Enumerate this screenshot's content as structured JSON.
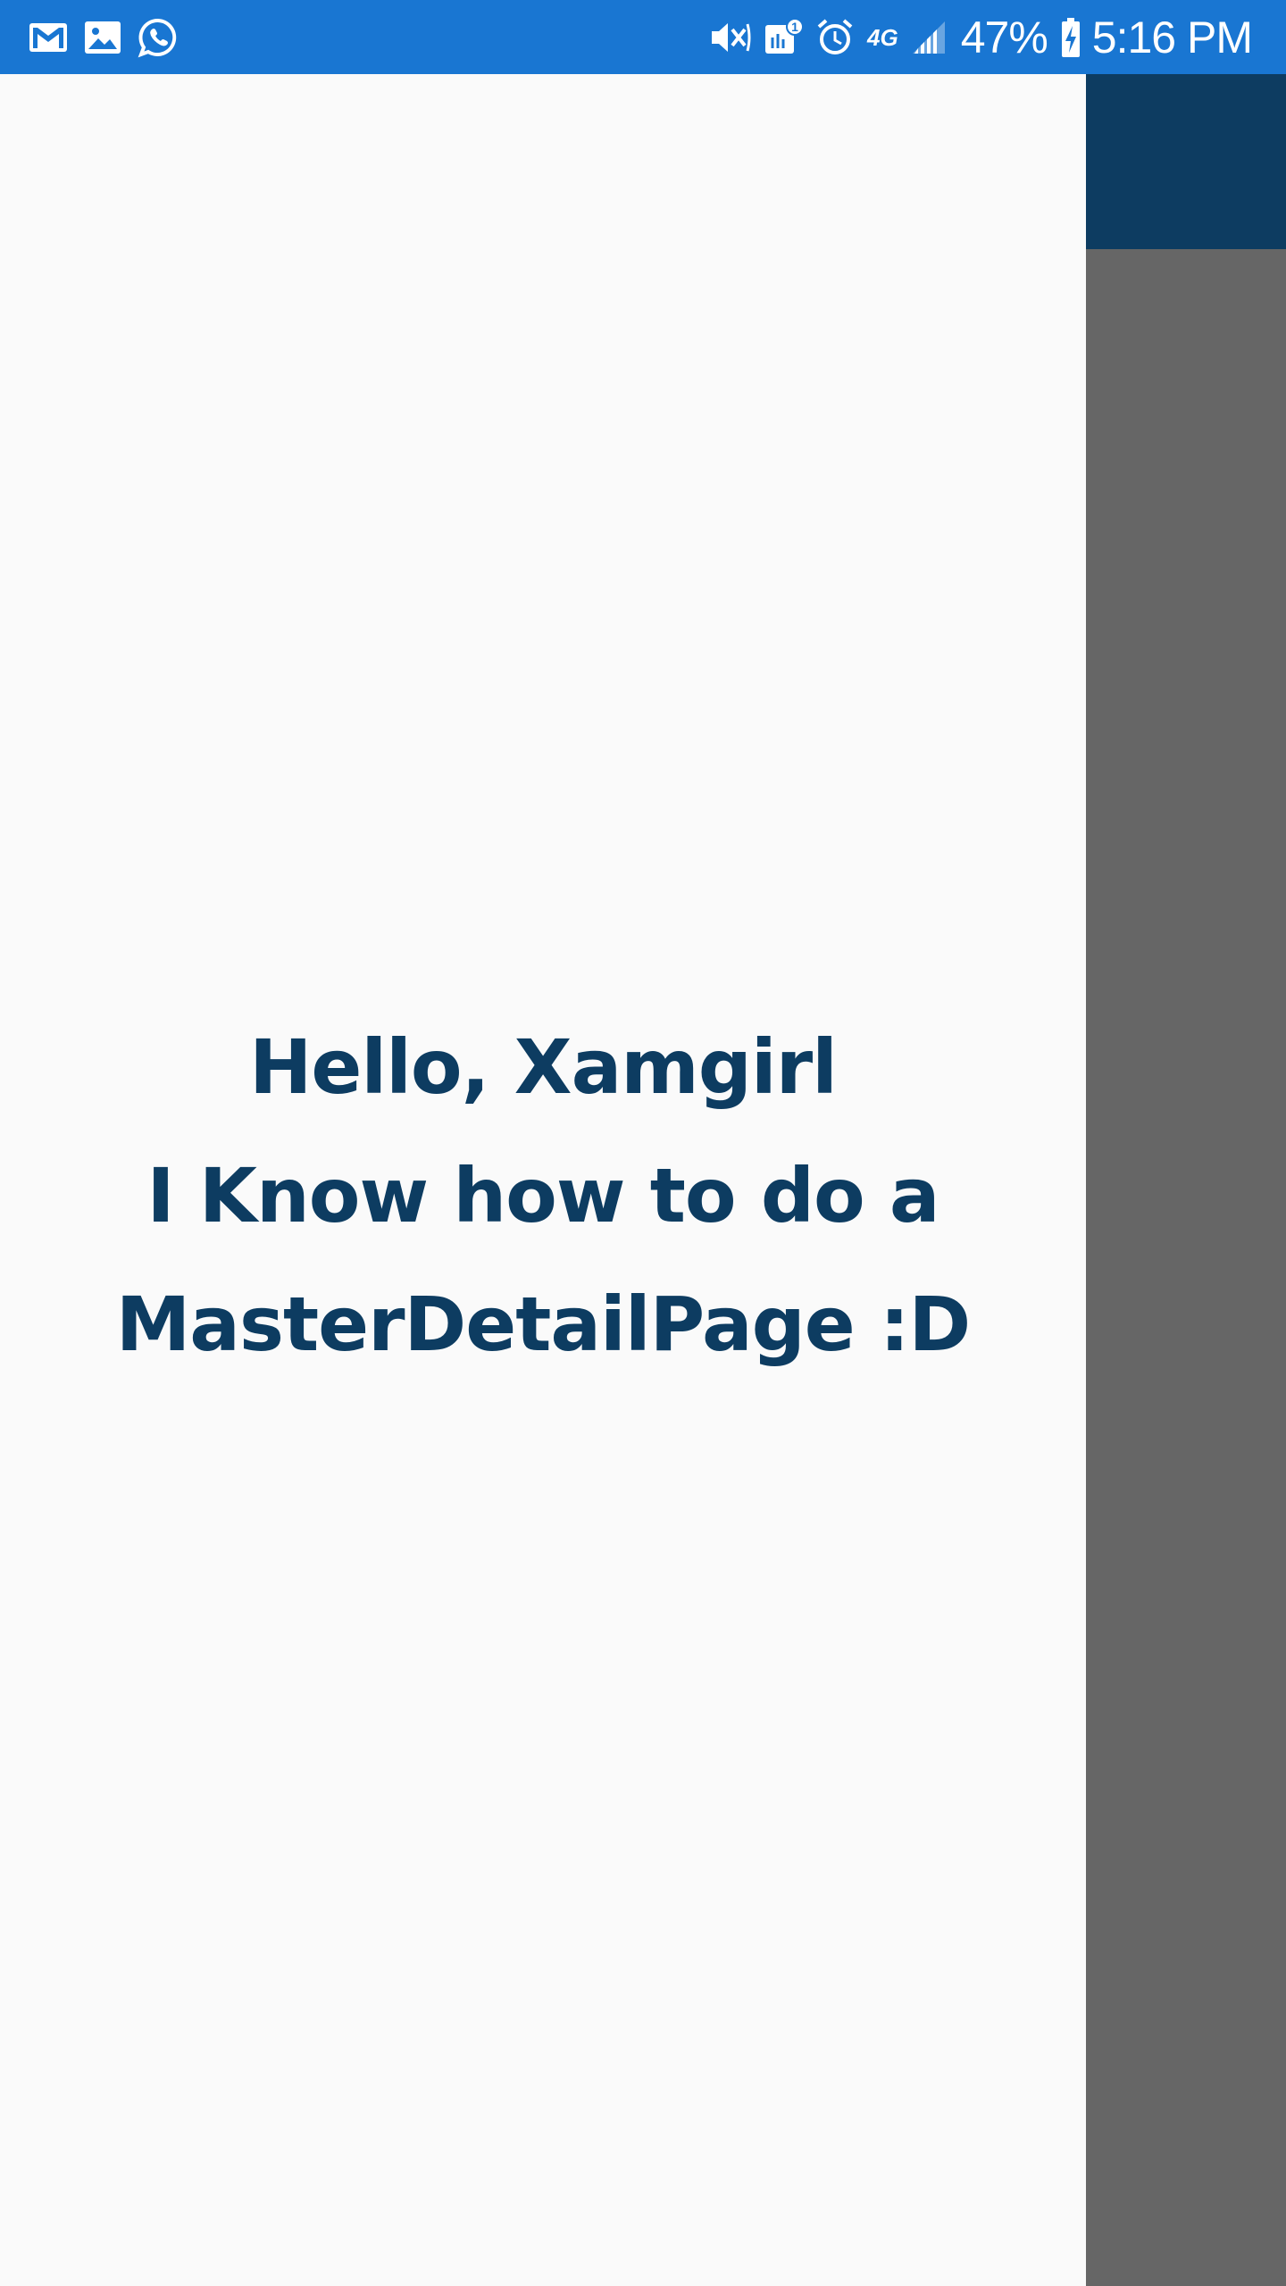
{
  "status_bar": {
    "background_color": "#1976d2",
    "left_icons": [
      "gmail-icon",
      "gallery-icon",
      "whatsapp-icon"
    ],
    "right_icons": [
      "mute-icon",
      "hotspot-icon",
      "alarm-icon",
      "network-4g-lte-icon",
      "signal-icon",
      "battery-charging-icon"
    ],
    "network_label": "4G",
    "battery_percent": "47%",
    "time": "5:16 PM"
  },
  "drawer": {
    "background_color": "#fafafa",
    "text_color": "#0d3c61",
    "message_lines": [
      "Hello, Xamgirl",
      "I Know how to do a",
      "MasterDetailPage :D"
    ]
  },
  "detail": {
    "toolbar_color": "#0d3c61",
    "overlay_color": "#666666"
  }
}
